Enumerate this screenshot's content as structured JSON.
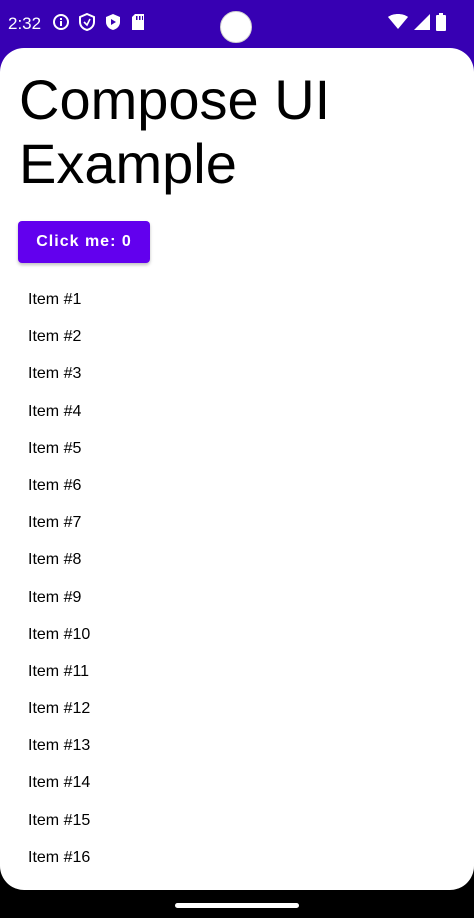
{
  "status_bar": {
    "time": "2:32",
    "background_color": "#3700b3",
    "left_icons": [
      "info-icon",
      "shield-icon",
      "play-protect-icon",
      "sd-card-icon"
    ],
    "right_icons": [
      "wifi-icon",
      "cell-signal-icon",
      "battery-icon"
    ]
  },
  "main": {
    "title": "Compose UI Example",
    "button": {
      "label": "Click me: 0",
      "color": "#6200ee"
    },
    "items": [
      "Item #1",
      "Item #2",
      "Item #3",
      "Item #4",
      "Item #5",
      "Item #6",
      "Item #7",
      "Item #8",
      "Item #9",
      "Item #10",
      "Item #11",
      "Item #12",
      "Item #13",
      "Item #14",
      "Item #15",
      "Item #16"
    ]
  },
  "nav_bar": {
    "handle": "home-gesture-handle"
  }
}
